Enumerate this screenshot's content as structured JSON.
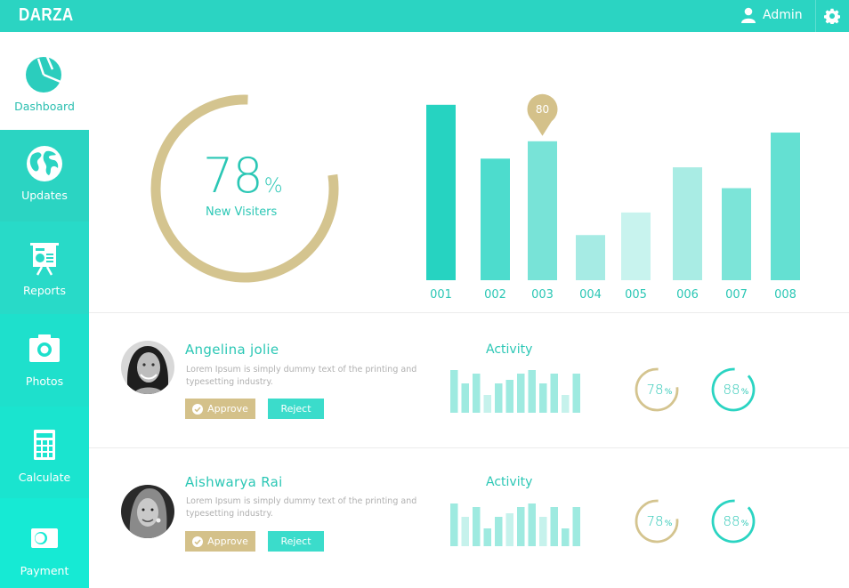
{
  "app": {
    "brand": "DARZA"
  },
  "topbar": {
    "user_label": "Admin",
    "user_icon": "user-icon",
    "settings_icon": "gear-icon"
  },
  "sidebar": {
    "items": [
      {
        "label": "Dashboard",
        "icon": "pie-chart-icon",
        "active": true
      },
      {
        "label": "Updates",
        "icon": "globe-icon"
      },
      {
        "label": "Reports",
        "icon": "presentation-board-icon"
      },
      {
        "label": "Photos",
        "icon": "camera-icon"
      },
      {
        "label": "Calculate",
        "icon": "calculator-icon"
      },
      {
        "label": "Payment",
        "icon": "card-toggle-icon"
      }
    ]
  },
  "summary": {
    "value": "78",
    "symbol": "%",
    "label": "New Visiters",
    "fraction": 0.78,
    "ring_color": "#d4c48f"
  },
  "chart_data": {
    "type": "bar",
    "title": "",
    "xlabel": "",
    "ylabel": "",
    "categories": [
      "001",
      "002",
      "003",
      "004",
      "005",
      "006",
      "007",
      "008"
    ],
    "values": [
      101,
      70,
      80,
      26,
      39,
      65,
      53,
      85
    ],
    "colors": [
      "#26d3c1",
      "#4ddccd",
      "#78e3d7",
      "#a6ebe4",
      "#c8f3ee",
      "#a9ece4",
      "#7ce4d8",
      "#64e0d2"
    ],
    "ylim": [
      0,
      105
    ],
    "highlight": {
      "category": "003",
      "label": "80",
      "color": "#d4c18a"
    },
    "grid": false
  },
  "people": [
    {
      "name": "Angelina jolie",
      "description": "Lorem Ipsum is simply dummy text of the printing and typesetting industry.",
      "approve_label": "Approve",
      "reject_label": "Reject",
      "activity_title": "Activity",
      "activity": [
        48,
        33,
        44,
        20,
        33,
        37,
        44,
        48,
        33,
        44,
        20,
        44
      ],
      "activity_light": [
        false,
        false,
        false,
        true,
        false,
        false,
        false,
        false,
        false,
        false,
        true,
        false
      ],
      "ring1": {
        "value": "78",
        "symbol": "%",
        "fraction": 0.78,
        "color": "#d4c48f"
      },
      "ring2": {
        "value": "88",
        "symbol": "%",
        "fraction": 0.88,
        "color": "#2bd4c2"
      }
    },
    {
      "name": "Aishwarya Rai",
      "description": "Lorem Ipsum is simply dummy text of the printing and typesetting industry.",
      "approve_label": "Approve",
      "reject_label": "Reject",
      "activity_title": "Activity",
      "activity": [
        48,
        33,
        44,
        20,
        33,
        37,
        44,
        48,
        33,
        44,
        20,
        44
      ],
      "activity_light": [
        false,
        true,
        false,
        false,
        false,
        true,
        false,
        false,
        true,
        false,
        false,
        false
      ],
      "ring1": {
        "value": "78",
        "symbol": "%",
        "fraction": 0.78,
        "color": "#d4c48f"
      },
      "ring2": {
        "value": "88",
        "symbol": "%",
        "fraction": 0.88,
        "color": "#2bd4c2"
      }
    }
  ]
}
